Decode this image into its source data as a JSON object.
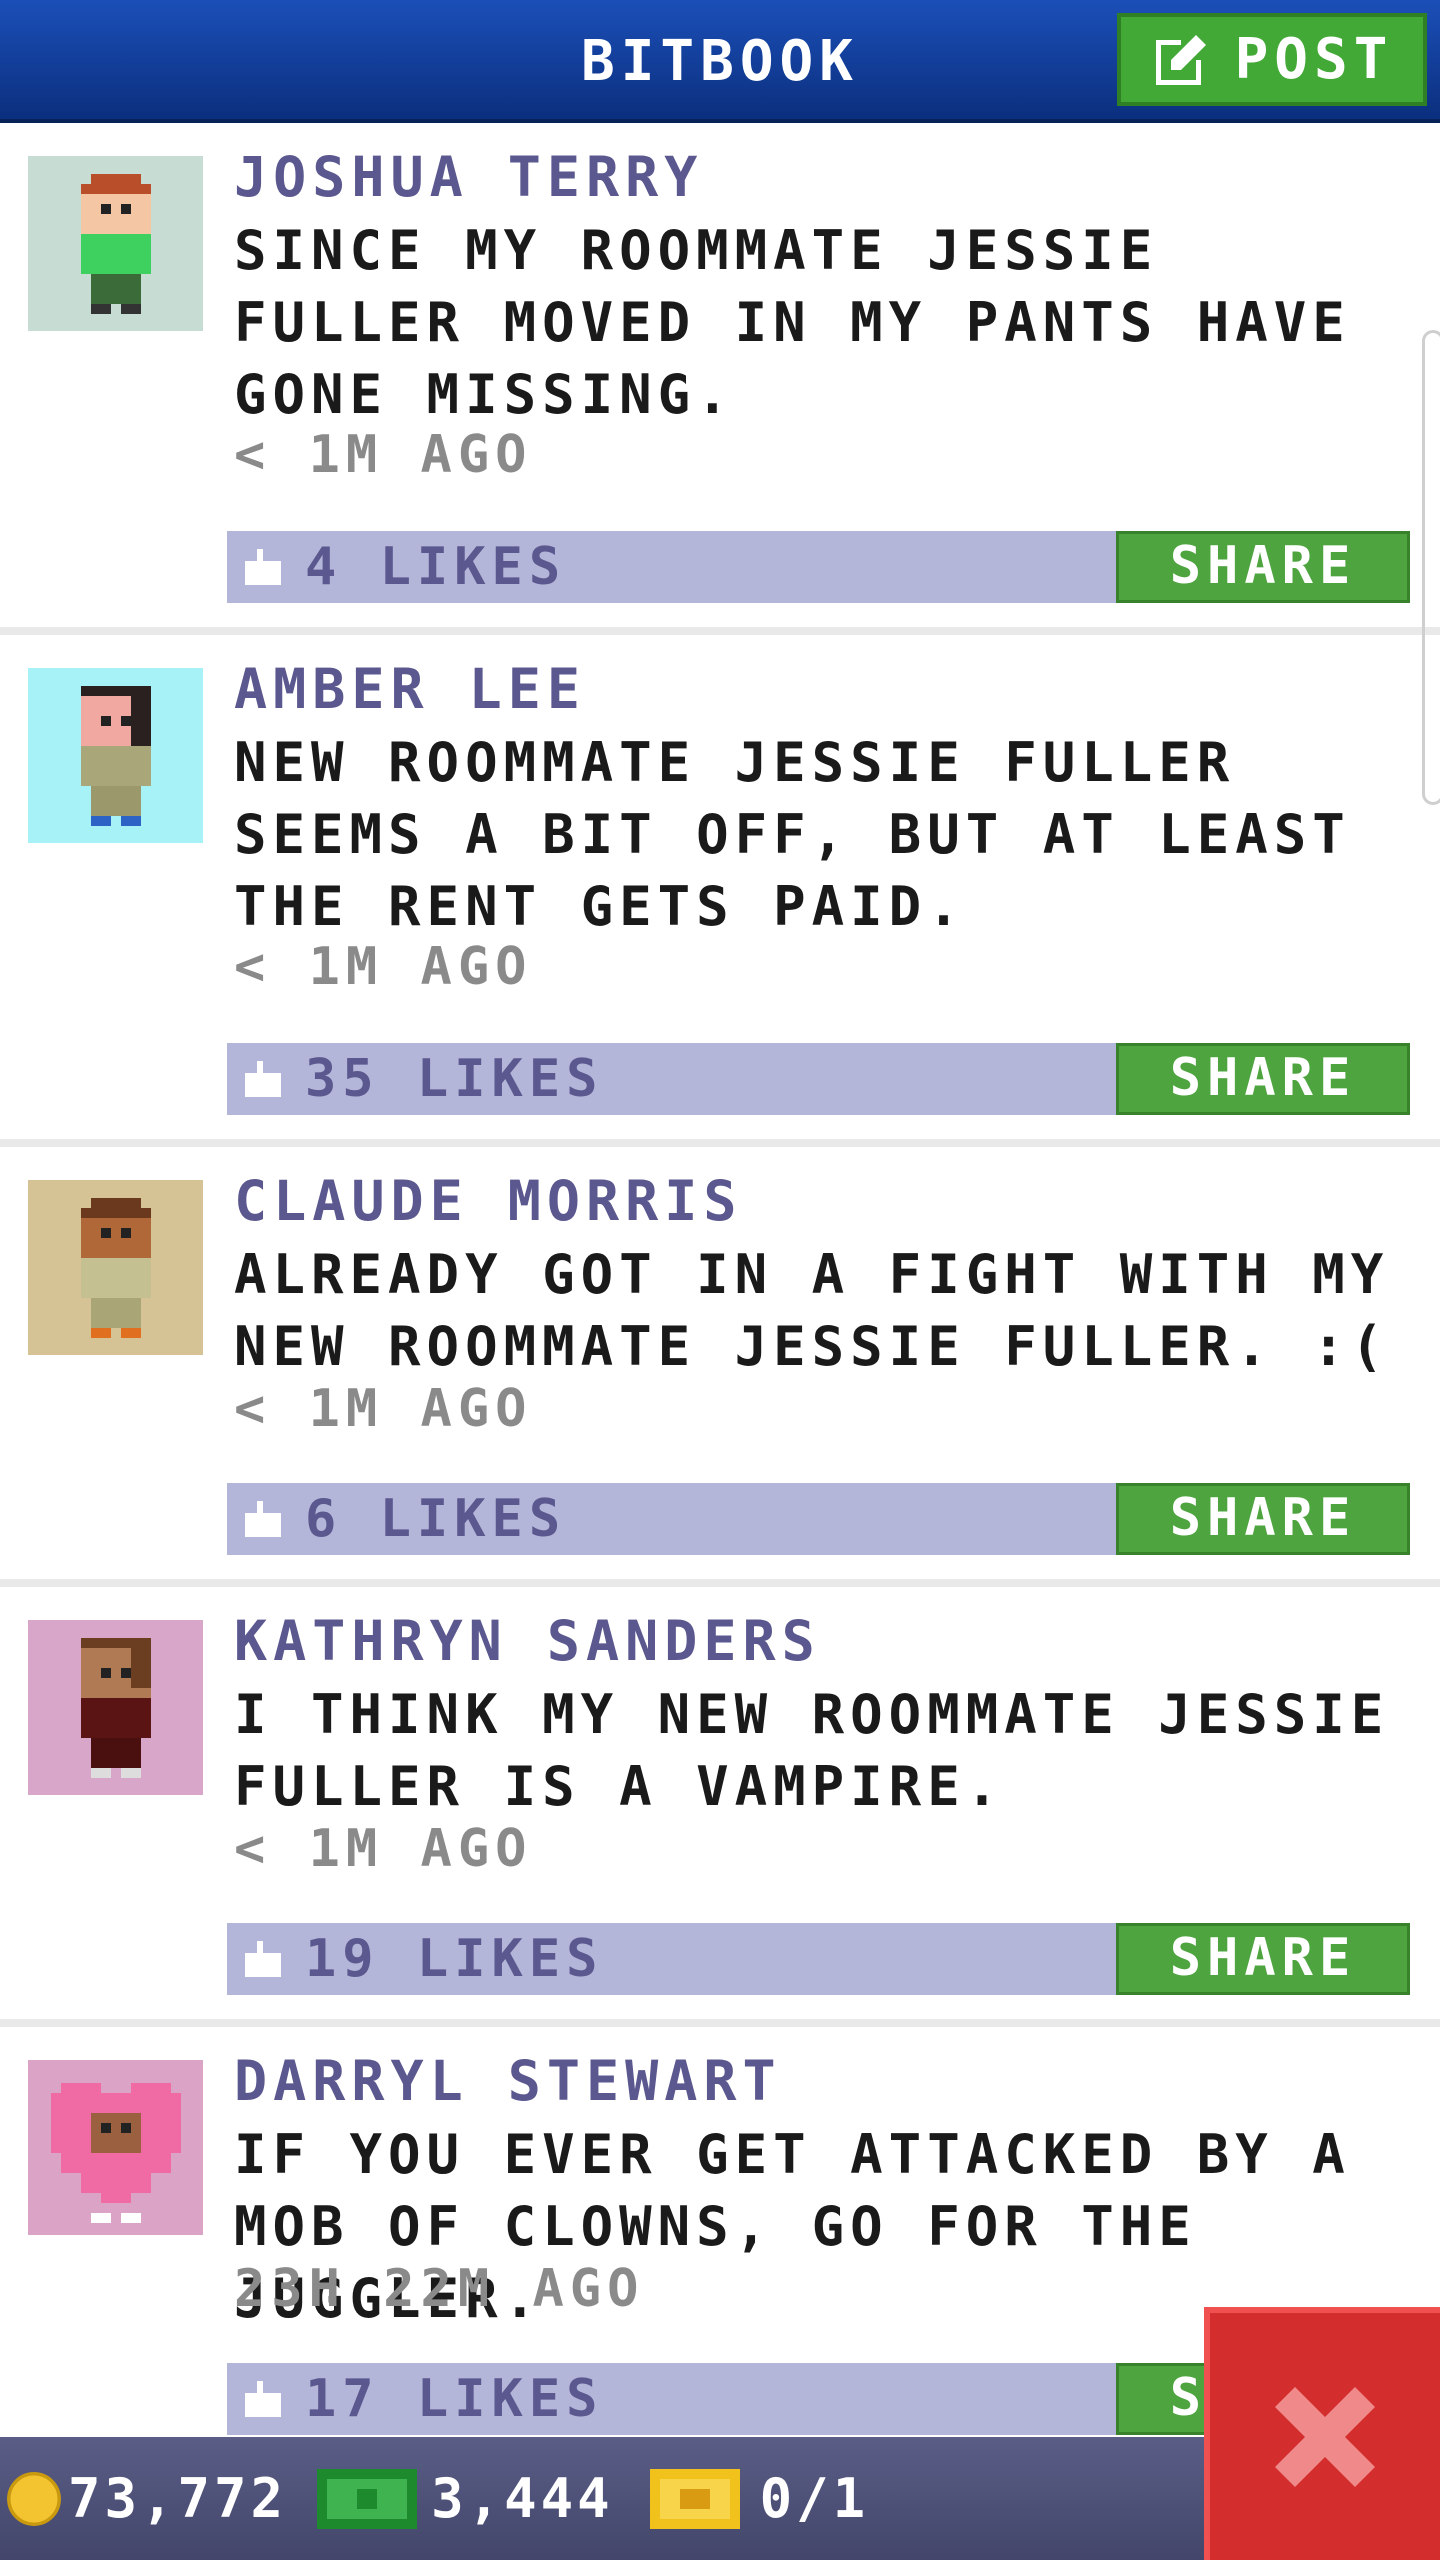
{
  "header": {
    "title": "BITBOOK",
    "post_label": "POST",
    "post_icon": "compose-icon"
  },
  "posts": [
    {
      "author": "JOSHUA TERRY",
      "message": "SINCE MY ROOMMATE JESSIE FULLER MOVED IN MY PANTS HAVE GONE MISSING.",
      "time": "< 1M AGO",
      "likes": "4 LIKES",
      "share_label": "SHARE",
      "avatar_bg": "#c7dcd2"
    },
    {
      "author": "AMBER LEE",
      "message": "NEW ROOMMATE JESSIE FULLER SEEMS A BIT OFF, BUT AT LEAST THE RENT GETS PAID.",
      "time": "< 1M AGO",
      "likes": "35 LIKES",
      "share_label": "SHARE",
      "avatar_bg": "#a6f2f7"
    },
    {
      "author": "CLAUDE MORRIS",
      "message": "ALREADY GOT IN A FIGHT WITH MY NEW ROOMMATE JESSIE FULLER. :(",
      "time": "< 1M AGO",
      "likes": "6 LIKES",
      "share_label": "SHARE",
      "avatar_bg": "#d5c295"
    },
    {
      "author": "KATHRYN SANDERS",
      "message": "I THINK MY NEW ROOMMATE JESSIE FULLER IS A VAMPIRE.",
      "time": "< 1M AGO",
      "likes": "19 LIKES",
      "share_label": "SHARE",
      "avatar_bg": "#d8a6c8"
    },
    {
      "author": "DARRYL STEWART",
      "message": "IF YOU EVER GET ATTACKED BY A MOB OF CLOWNS, GO FOR THE JUGGLER.",
      "time": "23H 22M AGO",
      "likes": "17 LIKES",
      "share_label": "SHARE",
      "avatar_bg": "#dba3c6"
    }
  ],
  "status_bar": {
    "coins": "73,772",
    "bux": "3,444",
    "tickets": "0/1"
  },
  "colors": {
    "header": "#1b4fb8",
    "name": "#5b588f",
    "likes_bar": "#b4b6d9",
    "share": "#4ea43f",
    "close": "#d42d2d"
  }
}
